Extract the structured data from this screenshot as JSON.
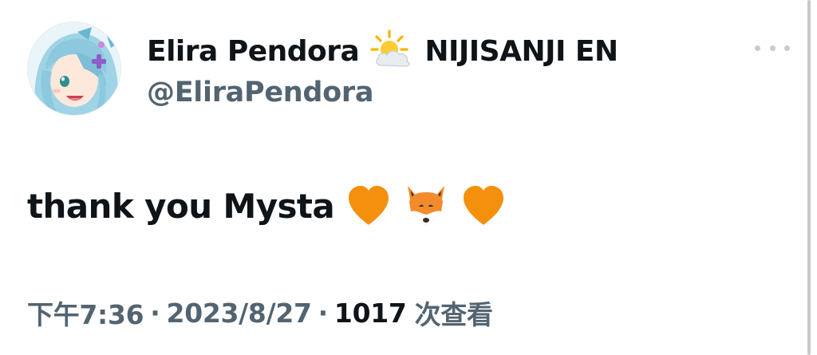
{
  "author": {
    "display_name": "Elira Pendora",
    "name_emoji": "sun-behind-cloud-icon",
    "affiliation": "NIJISANJI EN",
    "handle": "@EliraPendora",
    "avatar": "avatar-anime-girl-light-blue-hair"
  },
  "tweet": {
    "text": "thank you Mysta",
    "emojis": [
      "orange-heart-icon",
      "fox-face-icon",
      "orange-heart-icon"
    ]
  },
  "meta": {
    "time": "下午7:36",
    "separator": "·",
    "date": "2023/8/27",
    "views_count": "1017",
    "views_label": "次查看"
  },
  "colors": {
    "text_primary": "#0f1419",
    "text_secondary": "#536471",
    "heart_orange": "#f4900c",
    "fox_orange": "#f28b2c"
  }
}
